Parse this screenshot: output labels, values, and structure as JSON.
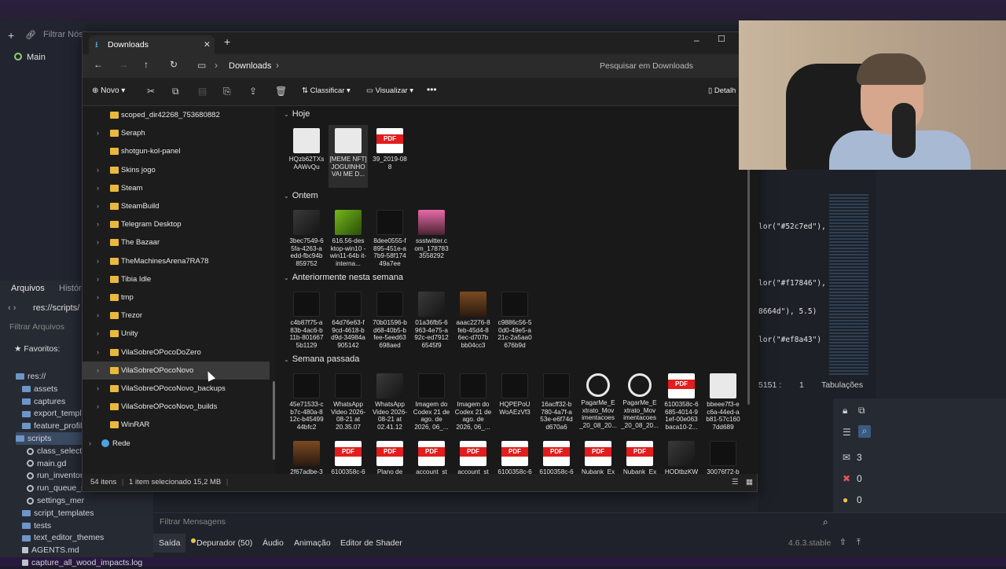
{
  "godot": {
    "filter_nodes_placeholder": "Filtrar Nós",
    "scene_root": "Main",
    "fs_tabs": [
      "Arquivos",
      "Histór"
    ],
    "path": "res://scripts/",
    "filter_files_placeholder": "Filtrar Arquivos",
    "favorites": "Favoritos:",
    "tree": [
      {
        "label": "res://",
        "type": "folder"
      },
      {
        "label": "assets",
        "type": "folder"
      },
      {
        "label": "captures",
        "type": "folder"
      },
      {
        "label": "export_templa",
        "type": "folder"
      },
      {
        "label": "feature_profile",
        "type": "folder"
      },
      {
        "label": "scripts",
        "type": "folder",
        "selected": true
      },
      {
        "label": "class_select",
        "type": "gear"
      },
      {
        "label": "main.gd",
        "type": "gear"
      },
      {
        "label": "run_inventor",
        "type": "gear"
      },
      {
        "label": "run_queue_s",
        "type": "gear"
      },
      {
        "label": "settings_mer",
        "type": "gear"
      },
      {
        "label": "script_templates",
        "type": "folder"
      },
      {
        "label": "tests",
        "type": "folder"
      },
      {
        "label": "text_editor_themes",
        "type": "folder"
      },
      {
        "label": "AGENTS.md",
        "type": "file"
      },
      {
        "label": "capture_all_wood_impacts.log",
        "type": "file"
      }
    ],
    "code": [
      "lor(\"#52c7ed\"),",
      "lor(\"#f17846\"),",
      "8664d\"), 5.5)",
      "lor(\"#ef8a43\")"
    ],
    "cursor_pos": "5151 :",
    "cursor_col": "1",
    "indent": "Tabulações",
    "filter_messages_placeholder": "Filtrar Mensagens",
    "counts": [
      "3",
      "0",
      "0",
      "1"
    ],
    "bottom_tabs": [
      "Saída",
      "Depurador (50)",
      "Áudio",
      "Animação",
      "Editor de Shader"
    ],
    "version": "4.6.3.stable"
  },
  "explorer": {
    "tab_title": "Downloads",
    "breadcrumb": "Downloads",
    "search_placeholder": "Pesquisar em Downloads",
    "toolbar": {
      "new": "Novo",
      "sort": "Classificar",
      "view": "Visualizar",
      "details": "Detalh"
    },
    "sidebar": [
      {
        "label": "scoped_dir42268_753680882",
        "chev": false
      },
      {
        "label": "Seraph",
        "chev": true
      },
      {
        "label": "shotgun-kol-panel",
        "chev": false
      },
      {
        "label": "Skins jogo",
        "chev": true
      },
      {
        "label": "Steam",
        "chev": true
      },
      {
        "label": "SteamBuild",
        "chev": true
      },
      {
        "label": "Telegram Desktop",
        "chev": true
      },
      {
        "label": "The Bazaar",
        "chev": true
      },
      {
        "label": "TheMachinesArena7RA78",
        "chev": true
      },
      {
        "label": "Tibia Idle",
        "chev": true
      },
      {
        "label": "tmp",
        "chev": true
      },
      {
        "label": "Trezor",
        "chev": true
      },
      {
        "label": "Unity",
        "chev": true
      },
      {
        "label": "VilaSobreOPocoDoZero",
        "chev": true
      },
      {
        "label": "VilaSobreOPocoNovo",
        "chev": true,
        "selected": true
      },
      {
        "label": "VilaSobreOPocoNovo_backups",
        "chev": true
      },
      {
        "label": "VilaSobreOPocoNovo_builds",
        "chev": true
      },
      {
        "label": "WinRAR",
        "chev": false
      },
      {
        "label": "Rede",
        "chev": true,
        "network": true
      }
    ],
    "groups": [
      {
        "title": "Hoje",
        "files": [
          {
            "name": "HQzb62TXs AAWvQu",
            "kind": "light"
          },
          {
            "name": "[MEME NFT] JOGUINHO VAI ME D...",
            "kind": "light",
            "sel": true
          },
          {
            "name": "39_2019-08 8",
            "kind": "pdf"
          }
        ]
      },
      {
        "title": "Ontem",
        "files": [
          {
            "name": "3bec7549-6 5fa-4263-a edd-fbc94b 859752",
            "kind": "img"
          },
          {
            "name": "616.56-des ktop-win10 -win11-64b it-interna...",
            "kind": "green"
          },
          {
            "name": "8dee0555-f 895-451e-a 7b9-58f174 49a7ee",
            "kind": "dark"
          },
          {
            "name": "ssstwitter.c om_178783 3558292",
            "kind": "pink"
          }
        ]
      },
      {
        "title": "Anteriormente nesta semana",
        "files": [
          {
            "name": "c4b87f75-a 83b-4ac6-b 11b-801667 5b1129",
            "kind": "dark"
          },
          {
            "name": "64d76e63-f 9cd-4618-b d9d-34984a 905142",
            "kind": "dark"
          },
          {
            "name": "70b01596-b d68-40b5-b fee-5eed63 698aed",
            "kind": "dark"
          },
          {
            "name": "01a36fb5-6 963-4e75-a 92c-ed7912 6545f9",
            "kind": "img"
          },
          {
            "name": "aaac2276-8 feb-45d4-8 6ec-d707b bb04cc3",
            "kind": "warm"
          },
          {
            "name": "c9886c56-5 0d0-49e5-a 21c-2a5aa0 676b9d",
            "kind": "dark"
          }
        ]
      },
      {
        "title": "Semana passada",
        "files": [
          {
            "name": "45e71533-c b7c-480a-8 12c-b45499 44bfc2",
            "kind": "dark"
          },
          {
            "name": "WhatsApp Video 2026-08-21 at 20.35.07",
            "kind": "dark"
          },
          {
            "name": "WhatsApp Video 2026-08-21 at 02.41.12",
            "kind": "img"
          },
          {
            "name": "Imagem do Codex 21 de ago. de 2026, 06_...",
            "kind": "dark"
          },
          {
            "name": "Imagem do Codex 21 de ago. de 2026, 06_...",
            "kind": "dark"
          },
          {
            "name": "HQPEPoU WoAEzVf3",
            "kind": "dark"
          },
          {
            "name": "16acff32-b 780-4a7f-a 53e-e6f74d d670a6",
            "kind": "dark"
          },
          {
            "name": "PagarMe_E xtrato_Mov imentacoes _20_08_20...",
            "kind": "gpt"
          },
          {
            "name": "PagarMe_E xtrato_Mov imentacoes _20_08_20...",
            "kind": "gpt"
          },
          {
            "name": "6100358c-6 685-4014-9 1ef-00e063 baca10-2...",
            "kind": "pdf"
          },
          {
            "name": "bbeee7f3-e c6a-44ed-a b81-57c160 7dd689",
            "kind": "light"
          }
        ]
      },
      {
        "title": "",
        "files": [
          {
            "name": "2f67adbe-3 fb0-4d43-a",
            "kind": "warm"
          },
          {
            "name": "6100358c-6 685-4014-9",
            "kind": "pdf"
          },
          {
            "name": "Plano de Governo",
            "kind": "pdf"
          },
          {
            "name": "account_st atement_a2",
            "kind": "pdf"
          },
          {
            "name": "account_st atement_3a",
            "kind": "pdf"
          },
          {
            "name": "6100358c-6 685-4014-9",
            "kind": "pdf"
          },
          {
            "name": "6100358c-6 685-4014-9",
            "kind": "pdf"
          },
          {
            "name": "Nubank_Ex trato_de_C",
            "kind": "pdf"
          },
          {
            "name": "Nubank_Ex trato_de_C",
            "kind": "pdf"
          },
          {
            "name": "HQDtbzKW eA42M3C",
            "kind": "img"
          },
          {
            "name": "30076f72-b c0a-4e15-a",
            "kind": "dark"
          }
        ]
      }
    ],
    "status": {
      "count": "54 itens",
      "selected": "1 item selecionado 15,2 MB"
    }
  }
}
